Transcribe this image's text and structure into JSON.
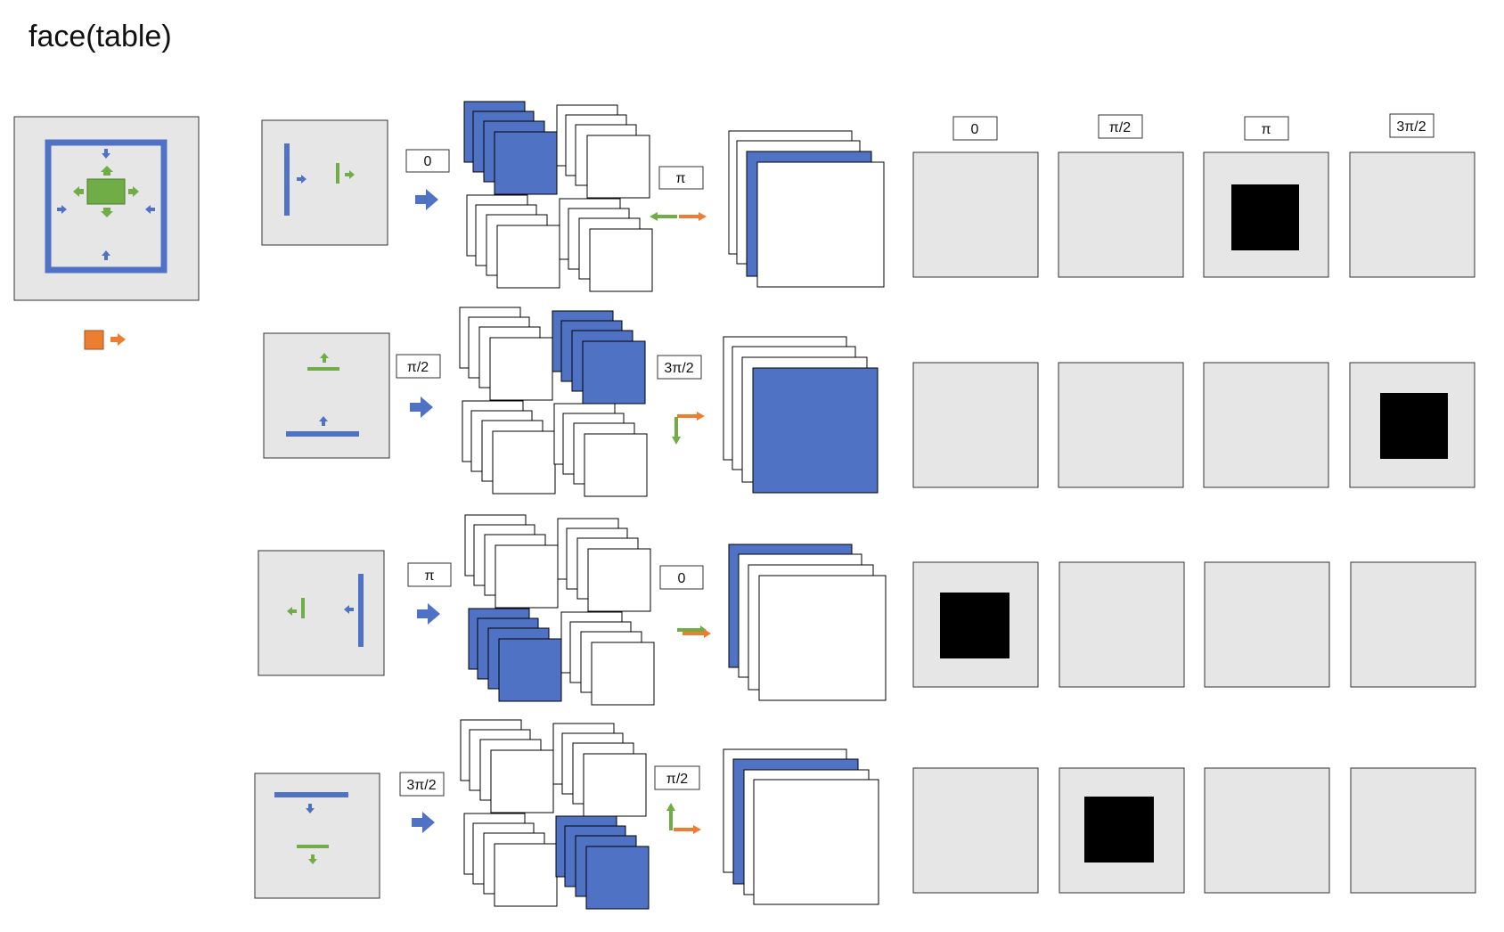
{
  "title": "face(table)",
  "colors": {
    "panel": "#e6e6e6",
    "blue": "#4f72c4",
    "green": "#70ad47",
    "orange": "#ed7d31",
    "black": "#000000",
    "white": "#ffffff"
  },
  "rows": [
    {
      "angle_label": "0",
      "result_label": "π",
      "active_index": 2
    },
    {
      "angle_label": "π/2",
      "result_label": "3π/2",
      "active_index": 3
    },
    {
      "angle_label": "π",
      "result_label": "0",
      "active_index": 0
    },
    {
      "angle_label": "3π/2",
      "result_label": "π/2",
      "active_index": 1
    }
  ],
  "column_headers": [
    "0",
    "π/2",
    "π",
    "3π/2"
  ]
}
